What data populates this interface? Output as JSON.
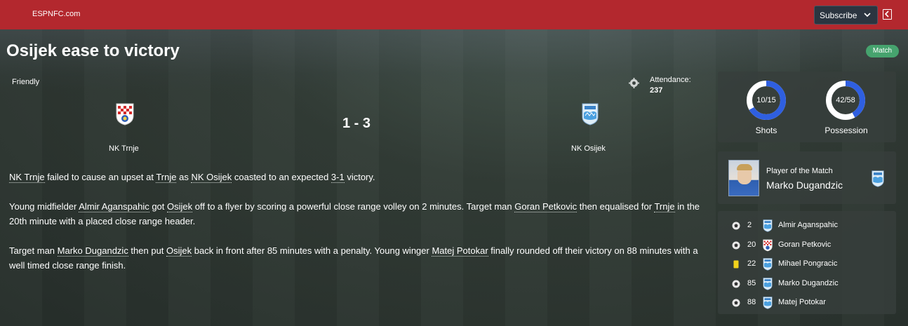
{
  "header": {
    "brand": "ESPNFC.com",
    "subscribe_label": "Subscribe"
  },
  "title": "Osijek ease to victory",
  "badge": "Match",
  "match": {
    "competition": "Friendly",
    "attendance_label": "Attendance:",
    "attendance_value": "237",
    "score": "1 - 3",
    "home_team": "NK Trnje",
    "away_team": "NK Osijek"
  },
  "report": {
    "p1": [
      "NK Trnje",
      " failed to cause an upset at ",
      "Trnje",
      " as ",
      "NK Osijek",
      " coasted to an expected ",
      "3-1",
      " victory."
    ],
    "p2": [
      "Young midfielder ",
      "Almir Aganspahic",
      " got ",
      "Osijek",
      " off to a flyer by scoring a powerful close range volley on 2 minutes. Target man ",
      "Goran Petkovic",
      " then equalised for ",
      "Trnje",
      " in the 20th minute with a placed close range header."
    ],
    "p3": [
      "Target man ",
      "Marko Dugandzic",
      " then put ",
      "Osijek",
      " back in front after 85 minutes with a penalty. Young winger ",
      "Matej Potokar",
      " finally rounded off their victory on 88 minutes with a well timed close range finish."
    ]
  },
  "stats": {
    "shots_text": "10/15",
    "shots_fraction": 0.667,
    "shots_label": "Shots",
    "poss_text": "42/58",
    "poss_fraction": 0.42,
    "poss_label": "Possession",
    "ring_color": "#2f5fe0",
    "ring_track": "#ffffff"
  },
  "potm": {
    "label": "Player of the Match",
    "name": "Marko Dugandzic"
  },
  "events": [
    {
      "icon": "ball-icon",
      "minute": "2",
      "team": "away",
      "player": "Almir Aganspahic"
    },
    {
      "icon": "ball-icon",
      "minute": "20",
      "team": "home",
      "player": "Goran Petkovic"
    },
    {
      "icon": "yellow-card-icon",
      "minute": "22",
      "team": "away",
      "player": "Mihael Pongracic"
    },
    {
      "icon": "ball-icon",
      "minute": "85",
      "team": "away",
      "player": "Marko Dugandzic"
    },
    {
      "icon": "ball-icon",
      "minute": "88",
      "team": "away",
      "player": "Matej Potokar"
    }
  ]
}
